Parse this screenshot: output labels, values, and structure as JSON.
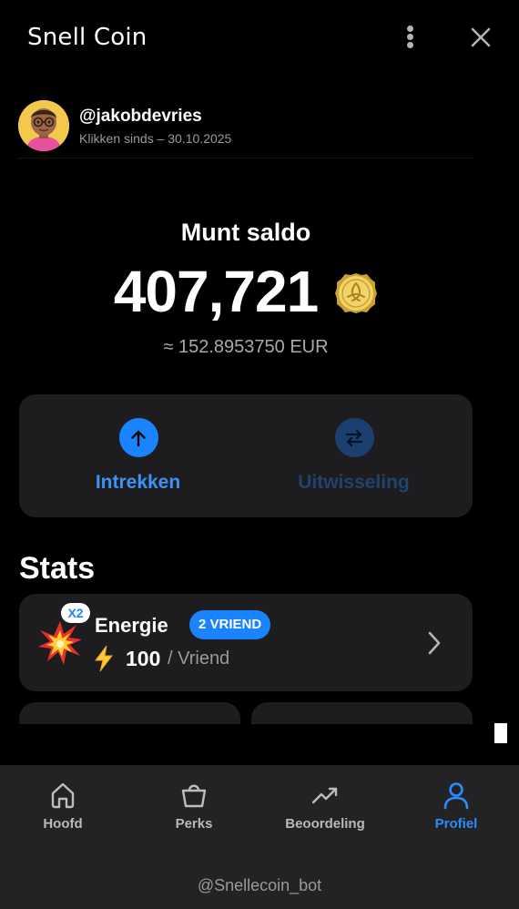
{
  "header": {
    "title": "Snell Coin"
  },
  "profile": {
    "username": "@jakobdevries",
    "since": "Klikken sinds – 30.10.2025"
  },
  "balance": {
    "title": "Munt saldo",
    "value": "407,721",
    "eur": "≈ 152.8953750 EUR"
  },
  "actions": {
    "withdraw_label": "Intrekken",
    "exchange_label": "Uitwisseling"
  },
  "stats": {
    "title": "Stats",
    "energy": {
      "badge": "X2",
      "name": "Energie",
      "pill": "2 VRIEND",
      "amount": "100",
      "unit": "/ Vriend"
    }
  },
  "nav": {
    "items": [
      {
        "label": "Hoofd",
        "icon": "home-icon"
      },
      {
        "label": "Perks",
        "icon": "shopping-bag-icon"
      },
      {
        "label": "Beoordeling",
        "icon": "trending-up-icon"
      },
      {
        "label": "Profiel",
        "icon": "user-icon",
        "active": true
      }
    ],
    "bot_handle": "@Snellecoin_bot"
  },
  "colors": {
    "accent": "#1a84ff",
    "background": "#000000",
    "card": "#1d1d1f",
    "nav": "#232325"
  }
}
